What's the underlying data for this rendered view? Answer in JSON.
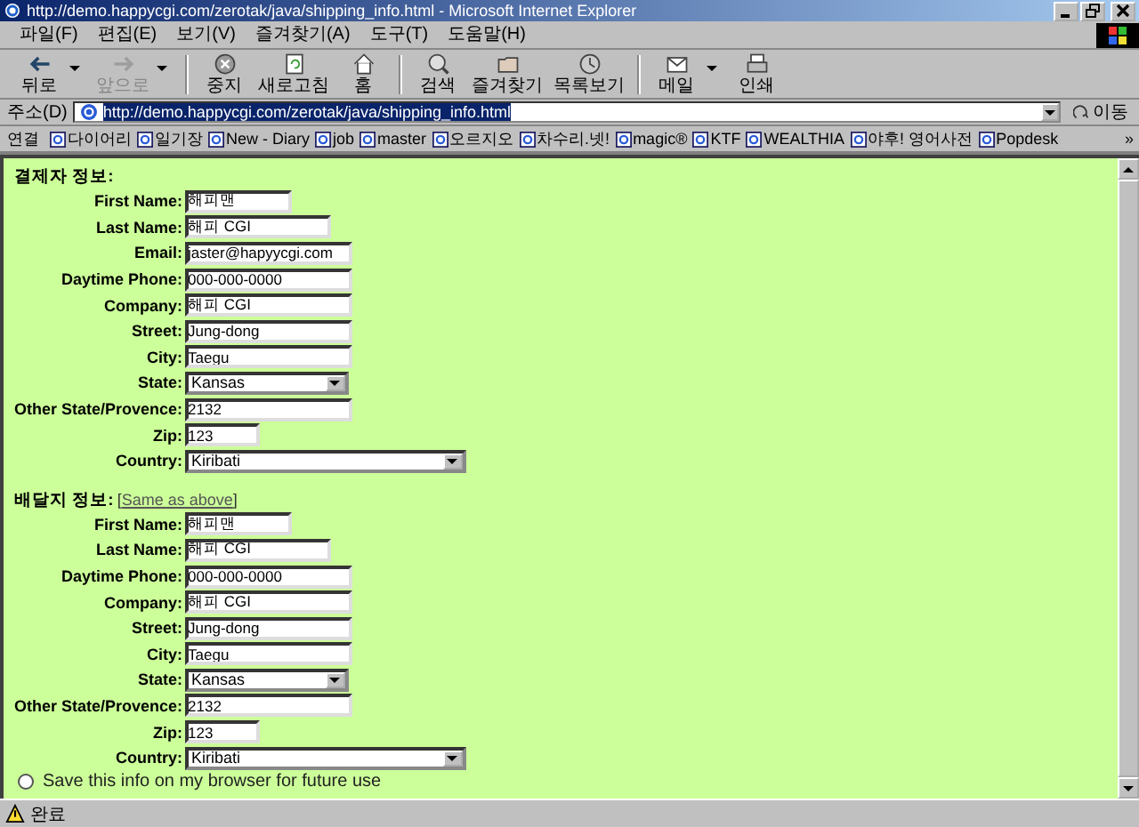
{
  "window": {
    "title": "http://demo.happycgi.com/zerotak/java/shipping_info.html - Microsoft Internet Explorer"
  },
  "menu": [
    "파일(F)",
    "편집(E)",
    "보기(V)",
    "즐겨찾기(A)",
    "도구(T)",
    "도움말(H)"
  ],
  "toolbar": [
    {
      "label": "뒤로",
      "kind": "back",
      "disabled": false,
      "dropdown": true
    },
    {
      "label": "앞으로",
      "kind": "forward",
      "disabled": true,
      "dropdown": true
    },
    {
      "label": "중지",
      "kind": "stop",
      "disabled": false,
      "dropdown": false
    },
    {
      "label": "새로고침",
      "kind": "refresh",
      "disabled": false,
      "dropdown": false
    },
    {
      "label": "홈",
      "kind": "home",
      "disabled": false,
      "dropdown": false
    },
    {
      "label": "검색",
      "kind": "search",
      "disabled": false,
      "dropdown": false
    },
    {
      "label": "즐겨찾기",
      "kind": "favorites",
      "disabled": false,
      "dropdown": false
    },
    {
      "label": "목록보기",
      "kind": "history",
      "disabled": false,
      "dropdown": false
    },
    {
      "label": "메일",
      "kind": "mail",
      "disabled": false,
      "dropdown": true
    },
    {
      "label": "인쇄",
      "kind": "print",
      "disabled": false,
      "dropdown": false
    }
  ],
  "address": {
    "label": "주소(D)",
    "value": "http://demo.happycgi.com/zerotak/java/shipping_info.html",
    "go": "이동"
  },
  "links": {
    "label": "연결",
    "items": [
      "다이어리",
      "일기장",
      "New - Diary",
      "job",
      "master",
      "오르지오",
      "차수리.넷!",
      "magic®",
      "KTF",
      "WEALTHIA",
      "야후! 영어사전",
      "Popdesk"
    ],
    "more": "»"
  },
  "sections": [
    {
      "heading": "결제자 정보:",
      "fields": [
        {
          "label": "First Name:",
          "value": "해피맨",
          "kind": "small"
        },
        {
          "label": "Last Name:",
          "value": "해피 CGI",
          "kind": "medium"
        },
        {
          "label": "Email:",
          "value": "jaster@hapyycgi.com",
          "kind": "large"
        },
        {
          "label": "Daytime Phone:",
          "value": "000-000-0000",
          "kind": "large"
        },
        {
          "label": "Company:",
          "value": "해피 CGI",
          "kind": "large"
        },
        {
          "label": "Street:",
          "value": "Jung-dong",
          "kind": "large"
        },
        {
          "label": "City:",
          "value": "Taegu",
          "kind": "large"
        },
        {
          "label": "State:",
          "value": "Kansas",
          "kind": "select"
        },
        {
          "label": "Other State/Provence:",
          "value": "2132",
          "kind": "large"
        },
        {
          "label": "Zip:",
          "value": "123",
          "kind": "tiny"
        },
        {
          "label": "Country:",
          "value": "Kiribati",
          "kind": "wideselect"
        }
      ]
    },
    {
      "heading": "배달지 정보:",
      "link": {
        "open": "[",
        "text": "Same as above",
        "close": "]"
      },
      "fields": [
        {
          "label": "First Name:",
          "value": "해피맨",
          "kind": "small"
        },
        {
          "label": "Last Name:",
          "value": "해피 CGI",
          "kind": "medium"
        },
        {
          "label": "Daytime Phone:",
          "value": "000-000-0000",
          "kind": "large"
        },
        {
          "label": "Company:",
          "value": "해피 CGI",
          "kind": "large"
        },
        {
          "label": "Street:",
          "value": "Jung-dong",
          "kind": "large"
        },
        {
          "label": "City:",
          "value": "Taegu",
          "kind": "large"
        },
        {
          "label": "State:",
          "value": "Kansas",
          "kind": "select"
        },
        {
          "label": "Other State/Provence:",
          "value": "2132",
          "kind": "large"
        },
        {
          "label": "Zip:",
          "value": "123",
          "kind": "tiny"
        },
        {
          "label": "Country:",
          "value": "Kiribati",
          "kind": "wideselect"
        }
      ]
    }
  ],
  "save_option": {
    "label": "Save this info on my browser for future use",
    "selected": false
  },
  "status_bar": {
    "text": "완료"
  }
}
